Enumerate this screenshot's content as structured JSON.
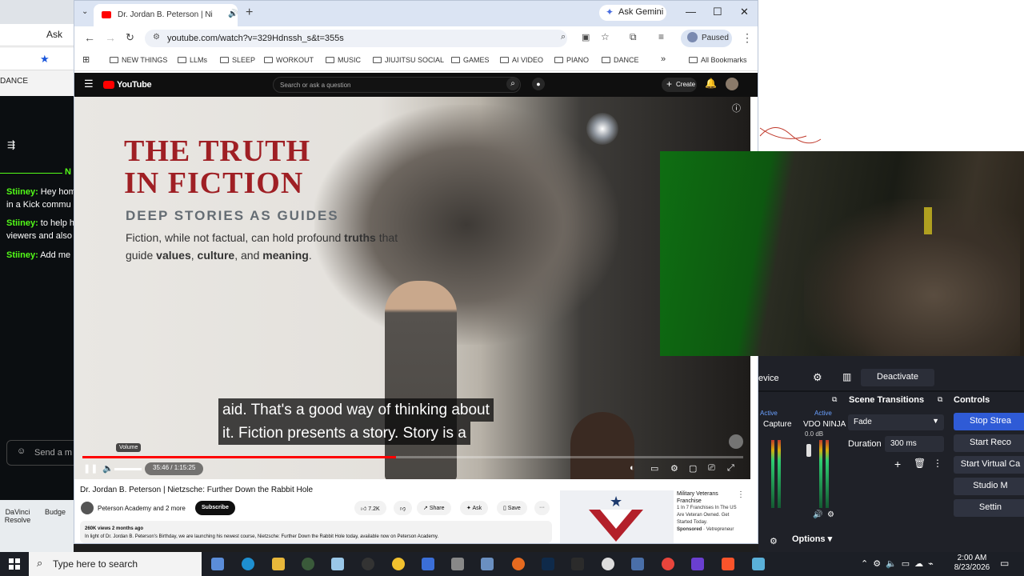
{
  "left_window": {
    "ask_label": "Ask",
    "bookmark": "DANCE",
    "chat": [
      {
        "user": "Stiiney:",
        "text": "Hey hom"
      },
      {
        "user": "",
        "text": "in a Kick commu"
      },
      {
        "user": "Stiiney:",
        "text": "to help h"
      },
      {
        "user": "",
        "text": "viewers and also"
      },
      {
        "user": "Stiiney:",
        "text": "Add me"
      }
    ],
    "chat_header": "N",
    "send_placeholder": "Send a m",
    "desktop_icons": [
      "DaVinci Resolve",
      "Budge"
    ]
  },
  "browser": {
    "tab_title": "Dr. Jordan B. Peterson | Ni",
    "ask_gemini": "Ask Gemini",
    "url": "youtube.com/watch?v=329Hdnssh_s&t=355s",
    "paused_label": "Paused",
    "bookmarks": [
      "NEW THINGS",
      "LLMs",
      "SLEEP",
      "WORKOUT",
      "MUSIC",
      "JIUJITSU SOCIAL",
      "GAMES",
      "AI VIDEO",
      "PIANO",
      "DANCE"
    ],
    "all_bookmarks": "All Bookmarks"
  },
  "youtube": {
    "logo": "YouTube",
    "search_placeholder": "Search or ask a question",
    "create_label": "Create",
    "video": {
      "title_line1": "THE TRUTH",
      "title_line2": "IN FICTION",
      "subtitle": "DEEP STORIES AS GUIDES",
      "body_prefix": "Fiction, while not factual, can hold profound ",
      "body_bold1": "truths",
      "body_mid": " that guide ",
      "body_bold2": "values",
      "body_sep": ", ",
      "body_bold3": "culture",
      "body_and": ", and ",
      "body_bold4": "meaning",
      "body_end": ".",
      "caption_line1": "aid. That's a good way of thinking about",
      "caption_line2": "it. Fiction presents a story. Story is a",
      "volume_tooltip": "Volume",
      "time": "35:46 / 1:15:25",
      "progress_fraction": 0.474
    },
    "meta": {
      "title": "Dr. Jordan B. Peterson | Nietzsche: Further Down the Rabbit Hole",
      "channel": "Peterson Academy and 2 more",
      "subscribe": "Subscribe",
      "likes": "7.2K",
      "share": "Share",
      "ask": "Ask",
      "save": "Save",
      "stats": "260K views  2 months ago",
      "description": "In light of Dr. Jordan B. Peterson's Birthday, we are launching his newest course, Nietzsche: Further Down the Rabbit Hole today, available now on Peterson Academy."
    },
    "ad": {
      "title": "Military Veterans Franchise",
      "line1": "1 In 7 Franchises In The US Are Veteran Owned. Get Started Today.",
      "sponsored": "Sponsored",
      "advertiser": "Vetrepreneur"
    }
  },
  "obs": {
    "device_label": "evice",
    "deactivate": "Deactivate",
    "scene_transitions": "Scene Transitions",
    "controls": "Controls",
    "active1": "Active",
    "active2": "Active",
    "capture": "Capture",
    "vdo": "VDO NINJA",
    "db": "0.0 dB",
    "transition": "Fade",
    "duration_label": "Duration",
    "duration_value": "300 ms",
    "options": "Options",
    "buttons": [
      "Stop Strea",
      "Start Reco",
      "Start Virtual Ca",
      "Studio M",
      "Settin"
    ]
  },
  "taskbar": {
    "search_placeholder": "Type here to search",
    "time": "2:00 AM",
    "date": "8/23/2026"
  }
}
